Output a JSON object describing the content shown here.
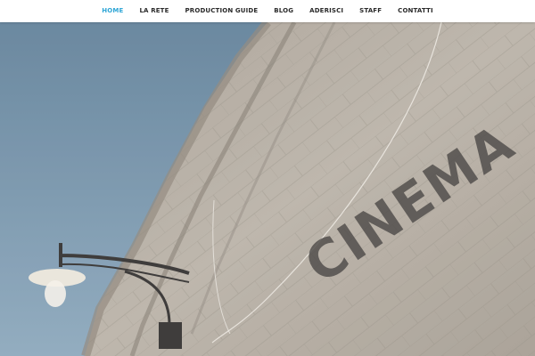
{
  "nav": {
    "items": [
      {
        "label": "HOME",
        "active": true
      },
      {
        "label": "LA RETE",
        "active": false
      },
      {
        "label": "PRODUCTION GUIDE",
        "active": false
      },
      {
        "label": "BLOG",
        "active": false
      },
      {
        "label": "ADERISCI",
        "active": false
      },
      {
        "label": "STAFF",
        "active": false
      },
      {
        "label": "CONTATTI",
        "active": false
      }
    ],
    "active_color": "#2fa6d6",
    "text_color": "#2a2a2a"
  },
  "hero": {
    "wall_sign": "CINEMA",
    "sky_color": "#6f8fa6",
    "wall_color": "#b3aba0"
  }
}
